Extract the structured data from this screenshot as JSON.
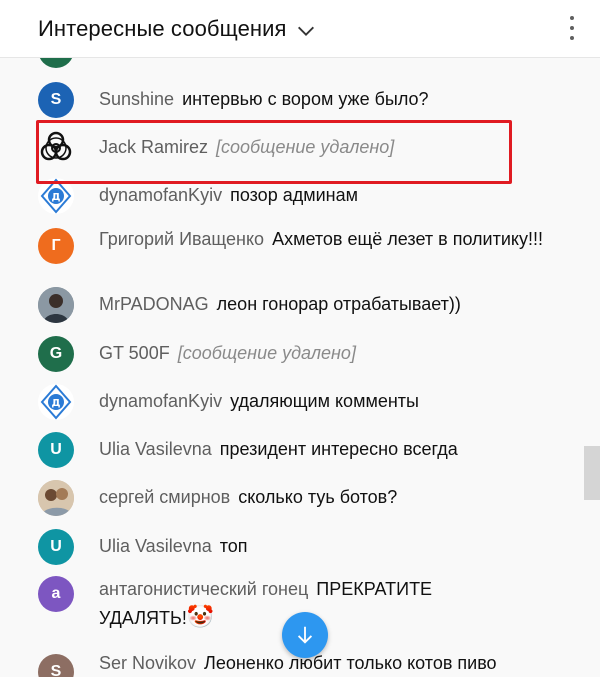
{
  "header": {
    "title": "Интересные сообщения"
  },
  "messages": [
    {
      "author": "Sunshine",
      "text": "интервью с вором уже было?",
      "avatar_letter": "S",
      "avatar_color": "#1c63b4"
    },
    {
      "author": "Jack Ramirez",
      "text": "[сообщение удалено]",
      "deleted": true,
      "avatar_icon": "biohazard-icon"
    },
    {
      "author": "dynamofanKyiv",
      "text": "позор админам",
      "avatar_icon": "dynamo-kyiv-logo-icon"
    },
    {
      "author": "Григорий Иващенко",
      "text": "Ахметов ещё лезет в политику!!!",
      "avatar_letter": "Г",
      "avatar_color": "#ef6c1e"
    },
    {
      "author": "MrPADONAG",
      "text": "леон гонорар отрабатывает))",
      "avatar_icon": "photo-avatar-man-icon"
    },
    {
      "author": "GT 500F",
      "text": "[сообщение удалено]",
      "deleted": true,
      "avatar_letter": "G",
      "avatar_color": "#1f6e4b"
    },
    {
      "author": "dynamofanKyiv",
      "text": "удаляющим комменты",
      "avatar_icon": "dynamo-kyiv-logo-icon"
    },
    {
      "author": "Ulia Vasilevna",
      "text": "президент интересно всегда",
      "avatar_letter": "U",
      "avatar_color": "#0f95a3"
    },
    {
      "author": "сергей смирнов",
      "text": "сколько туь ботов?",
      "avatar_icon": "photo-avatar-couple-icon"
    },
    {
      "author": "Ulia Vasilevna",
      "text": "топ",
      "avatar_letter": "U",
      "avatar_color": "#0f95a3"
    },
    {
      "author": "антагонистический гонец",
      "text": "ПРЕКРАТИТЕ УДАЛЯТЬ!",
      "emoji": "🤡",
      "avatar_letter": "a",
      "avatar_color": "#7d56c1"
    },
    {
      "author": "Ser Novikov",
      "text": "Леоненко любит только котов пиво",
      "avatar_letter": "S",
      "avatar_color": "#8d6e63"
    }
  ],
  "colors": {
    "highlight": "#e01b22",
    "scroll_button": "#2d97f0"
  }
}
